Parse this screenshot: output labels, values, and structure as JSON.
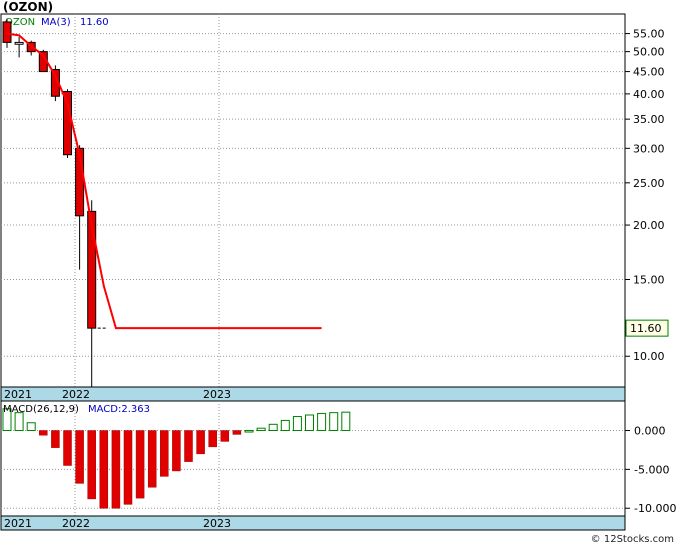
{
  "title": "(OZON)",
  "credit": "© 12Stocks.com",
  "chart_data": [
    {
      "type": "candlestick",
      "ticker": "OZON",
      "legend": [
        {
          "text": "OZON",
          "color": "#008000"
        },
        {
          "text": "MA(3)",
          "color": "#0000c0"
        },
        {
          "text": "11.60",
          "color": "#0000c0"
        }
      ],
      "last_value_label": "11.60",
      "y_scale": "log",
      "ylim": [
        8.5,
        61
      ],
      "yticks": [
        "10.00",
        "15.00",
        "20.00",
        "25.00",
        "30.00",
        "35.00",
        "40.00",
        "45.00",
        "50.00",
        "55.00"
      ],
      "x_labels": [
        "2021",
        "2022",
        "2023"
      ],
      "candles": [
        {
          "open": 58.5,
          "high": 59.5,
          "low": 51.0,
          "close": 52.5,
          "color": "red"
        },
        {
          "open": 52.5,
          "high": 54.0,
          "low": 48.5,
          "close": 52.0,
          "color": "white"
        },
        {
          "open": 52.5,
          "high": 53.0,
          "low": 49.0,
          "close": 50.0,
          "color": "red"
        },
        {
          "open": 50.0,
          "high": 50.5,
          "low": 45.0,
          "close": 45.0,
          "color": "red"
        },
        {
          "open": 45.5,
          "high": 46.5,
          "low": 38.5,
          "close": 39.5,
          "color": "red"
        },
        {
          "open": 40.5,
          "high": 41.0,
          "low": 28.5,
          "close": 29.0,
          "color": "red"
        },
        {
          "open": 30.0,
          "high": 30.5,
          "low": 15.8,
          "close": 21.0,
          "color": "red"
        },
        {
          "open": 21.5,
          "high": 22.8,
          "low": 8.5,
          "close": 11.6,
          "color": "red"
        }
      ],
      "ma3": [
        55.0,
        54.5,
        51.5,
        49.0,
        44.0,
        38.0,
        29.0,
        20.0,
        14.5,
        11.6,
        11.6,
        11.6,
        11.6,
        11.6,
        11.6,
        11.6,
        11.6,
        11.6,
        11.6,
        11.6,
        11.6,
        11.6,
        11.6,
        11.6,
        11.6,
        11.6,
        11.6
      ],
      "last_close_marker": 11.6,
      "grid": true
    },
    {
      "type": "bar",
      "title": "MACD(26,12,9)",
      "value_label": "MACD:2.363",
      "ylim": [
        -11,
        3.8
      ],
      "yticks": [
        "0.000",
        "-5.000",
        "-10.000"
      ],
      "x_labels": [
        "2021",
        "2022",
        "2023"
      ],
      "values": [
        2.8,
        2.3,
        1.0,
        -0.6,
        -2.2,
        -4.5,
        -6.8,
        -8.8,
        -10.0,
        -10.0,
        -9.5,
        -8.7,
        -7.3,
        -5.9,
        -5.2,
        -4.0,
        -3.0,
        -2.1,
        -1.4,
        -0.5,
        0.0,
        0.3,
        0.8,
        1.3,
        1.8,
        2.0,
        2.2,
        2.3,
        2.363
      ],
      "grid": true
    }
  ]
}
